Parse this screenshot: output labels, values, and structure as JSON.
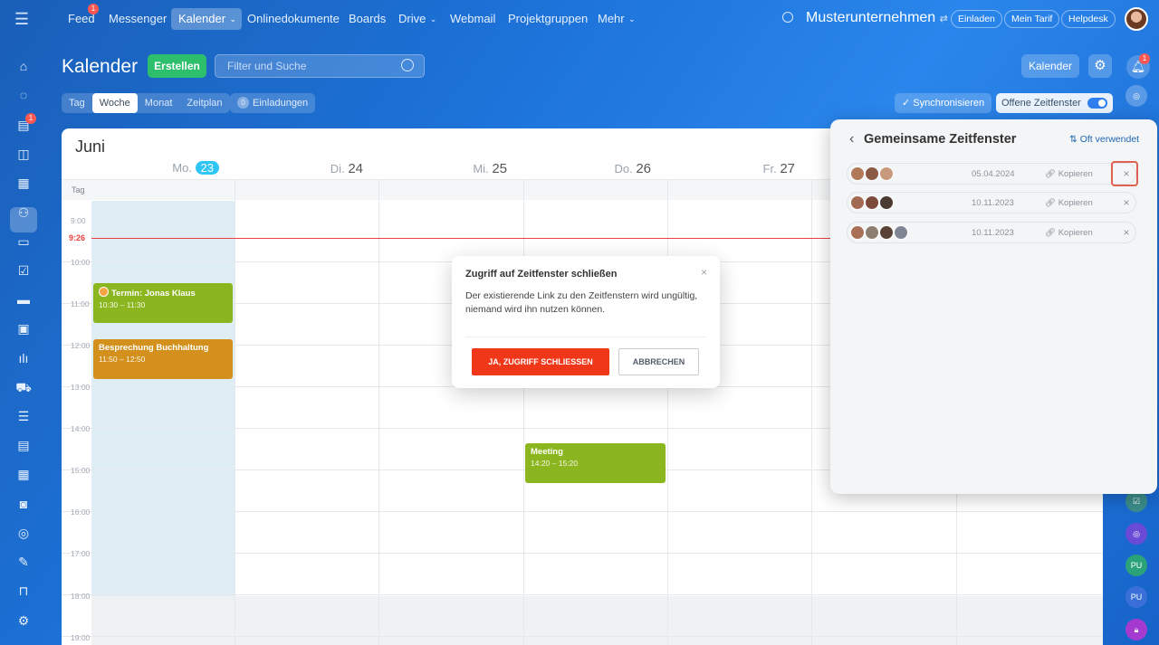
{
  "topnav": {
    "items": [
      "Feed",
      "Messenger",
      "Kalender",
      "Onlinedokumente",
      "Boards",
      "Drive",
      "Webmail",
      "Projektgruppen",
      "Mehr"
    ],
    "feed_badge": "1",
    "company": "Musterunternehmen",
    "invite": "Einladen",
    "plan": "Mein Tarif",
    "help": "Helpdesk"
  },
  "header": {
    "title": "Kalender",
    "create": "Erstellen",
    "search_placeholder": "Filter und Suche",
    "calendar_button": "Kalender",
    "bell_badge": "1"
  },
  "views": {
    "items": [
      "Tag",
      "Woche",
      "Monat",
      "Zeitplan"
    ],
    "active": "Woche",
    "invitations_count": "0",
    "invitations": "Einladungen",
    "sync": "Synchronisieren",
    "open_slots": "Offene Zeitfenster"
  },
  "calendar": {
    "month": "Juni",
    "days": [
      {
        "name": "Mo.",
        "num": "23"
      },
      {
        "name": "Di.",
        "num": "24"
      },
      {
        "name": "Mi.",
        "num": "25"
      },
      {
        "name": "Do.",
        "num": "26"
      },
      {
        "name": "Fr.",
        "num": "27"
      }
    ],
    "allday_label": "Tag",
    "hours": [
      "9:00",
      "10:00",
      "11:00",
      "12:00",
      "13:00",
      "14:00",
      "15:00",
      "16:00",
      "17:00",
      "18:00",
      "19:00"
    ],
    "now": "9:26",
    "events": [
      {
        "title": "Termin: Jonas Klaus",
        "time": "10:30 – 11:30",
        "color": "#8cb61f"
      },
      {
        "title": "Besprechung Buchhaltung",
        "time": "11:50 – 12:50",
        "color": "#d3901c"
      },
      {
        "title": "Meeting",
        "time": "14:20 – 15:20",
        "color": "#8cb61f"
      }
    ]
  },
  "panel": {
    "title": "Gemeinsame Zeitfenster",
    "sort": "Oft verwendet",
    "copy": "Kopieren",
    "slots": [
      {
        "date": "05.04.2024"
      },
      {
        "date": "10.11.2023"
      },
      {
        "date": "10.11.2023"
      }
    ]
  },
  "modal": {
    "title": "Zugriff auf Zeitfenster schließen",
    "text": "Der existierende Link zu den Zeitfenstern wird ungültig, niemand wird ihn nutzen können.",
    "confirm": "JA, ZUGRIFF SCHLIESSEN",
    "cancel": "ABBRECHEN"
  },
  "right_rail": {
    "badges": [
      "PU",
      "PU"
    ]
  }
}
